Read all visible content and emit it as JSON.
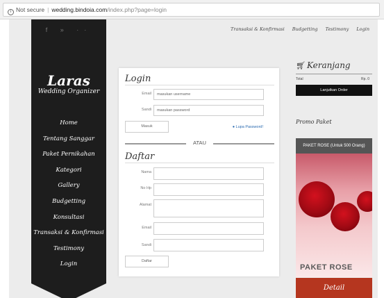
{
  "browser": {
    "security": "Not secure",
    "url_host": "wedding.bindoia.com",
    "url_path": "/index.php?page=login"
  },
  "sidebar": {
    "social": "f  »  ··",
    "logo_name": "Laras",
    "logo_sub": "Wedding Organizer",
    "items": [
      {
        "label": "Home"
      },
      {
        "label": "Tentang Sanggar"
      },
      {
        "label": "Paket Pernikahan"
      },
      {
        "label": "Kategori"
      },
      {
        "label": "Gallery"
      },
      {
        "label": "Budgetting"
      },
      {
        "label": "Konsultasi"
      },
      {
        "label": "Transaksi & Konfirmasi"
      },
      {
        "label": "Testimony"
      },
      {
        "label": "Login"
      }
    ]
  },
  "toplinks": [
    {
      "label": "Transaksi & Konfirmasi"
    },
    {
      "label": "Budgetting"
    },
    {
      "label": "Testimony"
    },
    {
      "label": "Login"
    }
  ],
  "login": {
    "title": "Login",
    "email_label": "Email",
    "email_placeholder": "masukan username",
    "password_label": "Sandi",
    "password_placeholder": "masukan password",
    "submit": "Masuk",
    "forgot": "● Lupa Password!"
  },
  "divider": "ATAU",
  "register": {
    "title": "Daftar",
    "name_label": "Nama",
    "phone_label": "No Hp",
    "address_label": "Alamat",
    "email_label": "Email",
    "password_label": "Sandi",
    "submit": "Daftar"
  },
  "cart": {
    "title": "Keranjang",
    "total_label": "Total",
    "total_value": "Rp. 0",
    "checkout": "Lanjutkan Order"
  },
  "promo": {
    "heading": "Promo Paket",
    "package_title": "PAKET ROSE (Untuk 500 Orang)",
    "image_text": "PAKET ROSE",
    "detail": "Detail"
  },
  "colors": {
    "sidebar_bg": "#1d1d1d",
    "detail_btn": "#b5361f",
    "checkout_btn": "#111111",
    "link": "#2a6ab0"
  }
}
